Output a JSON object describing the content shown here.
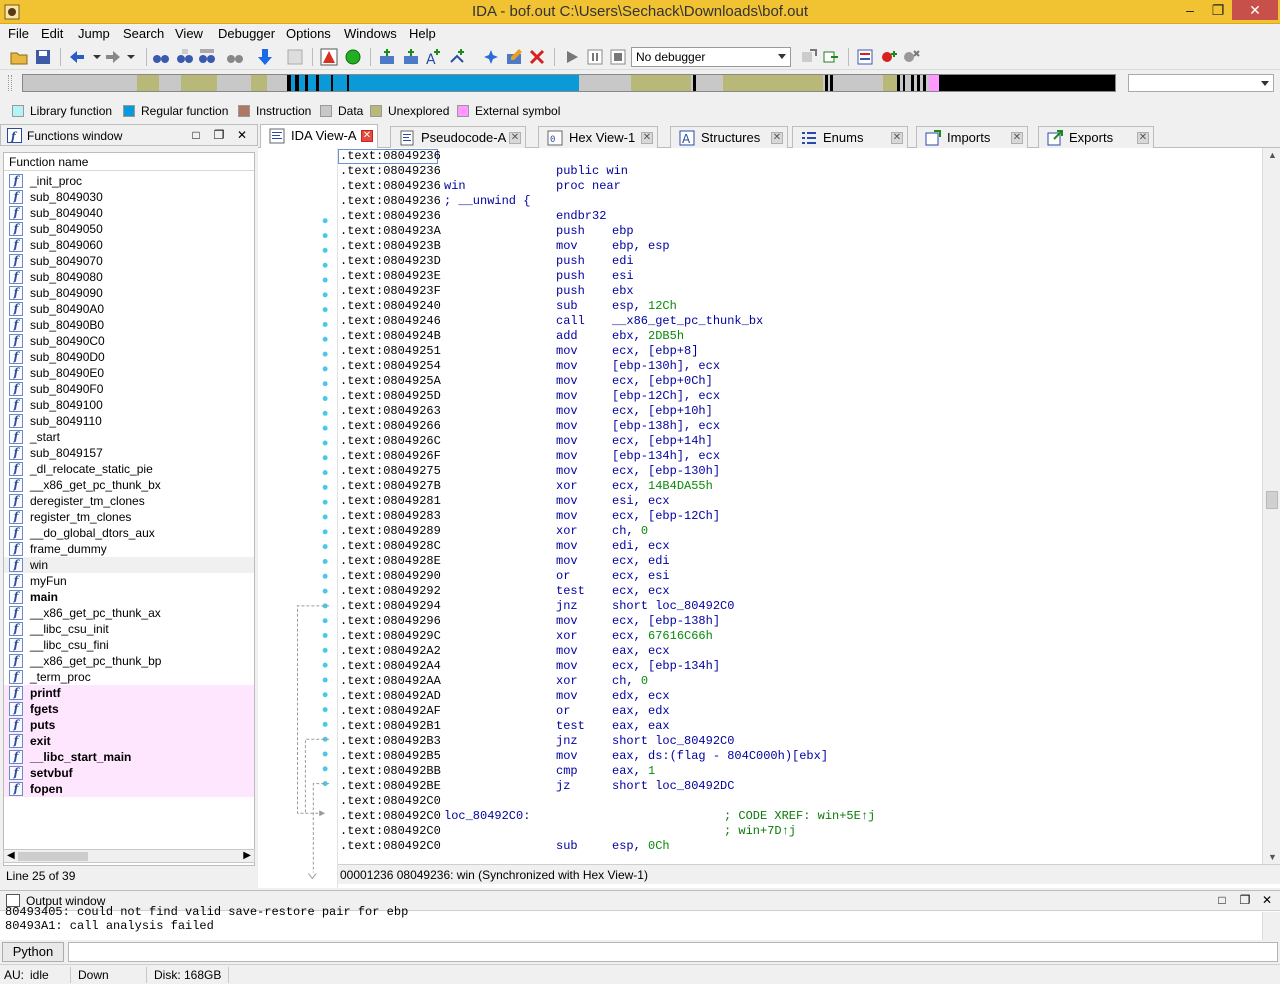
{
  "window": {
    "title": "IDA - bof.out C:\\Users\\Sechack\\Downloads\\bof.out"
  },
  "menu": [
    "File",
    "Edit",
    "Jump",
    "Search",
    "View",
    "Debugger",
    "Options",
    "Windows",
    "Help"
  ],
  "toolbar": {
    "debugger_select": "No debugger"
  },
  "legend": [
    {
      "label": "Library function",
      "color": "#b4f4f4"
    },
    {
      "label": "Regular function",
      "color": "#0a9ad8"
    },
    {
      "label": "Instruction",
      "color": "#b07860"
    },
    {
      "label": "Data",
      "color": "#c8c8c8"
    },
    {
      "label": "Unexplored",
      "color": "#b8b878"
    },
    {
      "label": "External symbol",
      "color": "#ff99ff"
    }
  ],
  "functions_window": {
    "title": "Functions window",
    "column": "Function name",
    "items": [
      {
        "name": "_init_proc",
        "kind": "regular"
      },
      {
        "name": "sub_8049030",
        "kind": "regular"
      },
      {
        "name": "sub_8049040",
        "kind": "regular"
      },
      {
        "name": "sub_8049050",
        "kind": "regular"
      },
      {
        "name": "sub_8049060",
        "kind": "regular"
      },
      {
        "name": "sub_8049070",
        "kind": "regular"
      },
      {
        "name": "sub_8049080",
        "kind": "regular"
      },
      {
        "name": "sub_8049090",
        "kind": "regular"
      },
      {
        "name": "sub_80490A0",
        "kind": "regular"
      },
      {
        "name": "sub_80490B0",
        "kind": "regular"
      },
      {
        "name": "sub_80490C0",
        "kind": "regular"
      },
      {
        "name": "sub_80490D0",
        "kind": "regular"
      },
      {
        "name": "sub_80490E0",
        "kind": "regular"
      },
      {
        "name": "sub_80490F0",
        "kind": "regular"
      },
      {
        "name": "sub_8049100",
        "kind": "regular"
      },
      {
        "name": "sub_8049110",
        "kind": "regular"
      },
      {
        "name": "_start",
        "kind": "regular"
      },
      {
        "name": "sub_8049157",
        "kind": "regular"
      },
      {
        "name": "_dl_relocate_static_pie",
        "kind": "regular"
      },
      {
        "name": "__x86_get_pc_thunk_bx",
        "kind": "regular"
      },
      {
        "name": "deregister_tm_clones",
        "kind": "regular"
      },
      {
        "name": "register_tm_clones",
        "kind": "regular"
      },
      {
        "name": "__do_global_dtors_aux",
        "kind": "regular"
      },
      {
        "name": "frame_dummy",
        "kind": "regular"
      },
      {
        "name": "win",
        "kind": "selected"
      },
      {
        "name": "myFun",
        "kind": "regular"
      },
      {
        "name": "main",
        "kind": "bold"
      },
      {
        "name": "__x86_get_pc_thunk_ax",
        "kind": "regular"
      },
      {
        "name": "__libc_csu_init",
        "kind": "regular"
      },
      {
        "name": "__libc_csu_fini",
        "kind": "regular"
      },
      {
        "name": "__x86_get_pc_thunk_bp",
        "kind": "regular"
      },
      {
        "name": "_term_proc",
        "kind": "regular"
      },
      {
        "name": "printf",
        "kind": "external"
      },
      {
        "name": "fgets",
        "kind": "external"
      },
      {
        "name": "puts",
        "kind": "external"
      },
      {
        "name": "exit",
        "kind": "external"
      },
      {
        "name": "__libc_start_main",
        "kind": "external"
      },
      {
        "name": "setvbuf",
        "kind": "external"
      },
      {
        "name": "fopen",
        "kind": "external"
      }
    ],
    "footer": "Line 25 of 39"
  },
  "tabs": [
    {
      "label": "IDA View-A",
      "active": true
    },
    {
      "label": "Pseudocode-A",
      "active": false
    },
    {
      "label": "Hex View-1",
      "active": false
    },
    {
      "label": "Structures",
      "active": false
    },
    {
      "label": "Enums",
      "active": false
    },
    {
      "label": "Imports",
      "active": false
    },
    {
      "label": "Exports",
      "active": false
    }
  ],
  "disasm": [
    {
      "addr": ".text:08049236"
    },
    {
      "addr": ".text:08049236",
      "dir": "public win"
    },
    {
      "addr": ".text:08049236",
      "lbl": "win",
      "dir": "proc near"
    },
    {
      "addr": ".text:08049236",
      "lbl": "; __unwind {"
    },
    {
      "addr": ".text:08049236",
      "mn": "endbr32"
    },
    {
      "addr": ".text:0804923A",
      "mn": "push",
      "op": "ebp"
    },
    {
      "addr": ".text:0804923B",
      "mn": "mov",
      "op": "ebp, esp"
    },
    {
      "addr": ".text:0804923D",
      "mn": "push",
      "op": "edi"
    },
    {
      "addr": ".text:0804923E",
      "mn": "push",
      "op": "esi"
    },
    {
      "addr": ".text:0804923F",
      "mn": "push",
      "op": "ebx"
    },
    {
      "addr": ".text:08049240",
      "mn": "sub",
      "op": "esp, ",
      "num": "12Ch"
    },
    {
      "addr": ".text:08049246",
      "mn": "call",
      "op": "__x86_get_pc_thunk_bx"
    },
    {
      "addr": ".text:0804924B",
      "mn": "add",
      "op": "ebx, ",
      "num": "2DB5h"
    },
    {
      "addr": ".text:08049251",
      "mn": "mov",
      "op": "ecx, [ebp+8]"
    },
    {
      "addr": ".text:08049254",
      "mn": "mov",
      "op": "[ebp-130h], ecx"
    },
    {
      "addr": ".text:0804925A",
      "mn": "mov",
      "op": "ecx, [ebp+0Ch]"
    },
    {
      "addr": ".text:0804925D",
      "mn": "mov",
      "op": "[ebp-12Ch], ecx"
    },
    {
      "addr": ".text:08049263",
      "mn": "mov",
      "op": "ecx, [ebp+10h]"
    },
    {
      "addr": ".text:08049266",
      "mn": "mov",
      "op": "[ebp-138h], ecx"
    },
    {
      "addr": ".text:0804926C",
      "mn": "mov",
      "op": "ecx, [ebp+14h]"
    },
    {
      "addr": ".text:0804926F",
      "mn": "mov",
      "op": "[ebp-134h], ecx"
    },
    {
      "addr": ".text:08049275",
      "mn": "mov",
      "op": "ecx, [ebp-130h]"
    },
    {
      "addr": ".text:0804927B",
      "mn": "xor",
      "op": "ecx, ",
      "num": "14B4DA55h"
    },
    {
      "addr": ".text:08049281",
      "mn": "mov",
      "op": "esi, ecx"
    },
    {
      "addr": ".text:08049283",
      "mn": "mov",
      "op": "ecx, [ebp-12Ch]"
    },
    {
      "addr": ".text:08049289",
      "mn": "xor",
      "op": "ch, ",
      "num": "0"
    },
    {
      "addr": ".text:0804928C",
      "mn": "mov",
      "op": "edi, ecx"
    },
    {
      "addr": ".text:0804928E",
      "mn": "mov",
      "op": "ecx, edi"
    },
    {
      "addr": ".text:08049290",
      "mn": "or",
      "op": "ecx, esi"
    },
    {
      "addr": ".text:08049292",
      "mn": "test",
      "op": "ecx, ecx"
    },
    {
      "addr": ".text:08049294",
      "mn": "jnz",
      "op": "short loc_80492C0"
    },
    {
      "addr": ".text:08049296",
      "mn": "mov",
      "op": "ecx, [ebp-138h]"
    },
    {
      "addr": ".text:0804929C",
      "mn": "xor",
      "op": "ecx, ",
      "num": "67616C66h"
    },
    {
      "addr": ".text:080492A2",
      "mn": "mov",
      "op": "eax, ecx"
    },
    {
      "addr": ".text:080492A4",
      "mn": "mov",
      "op": "ecx, [ebp-134h]"
    },
    {
      "addr": ".text:080492AA",
      "mn": "xor",
      "op": "ch, ",
      "num": "0"
    },
    {
      "addr": ".text:080492AD",
      "mn": "mov",
      "op": "edx, ecx"
    },
    {
      "addr": ".text:080492AF",
      "mn": "or",
      "op": "eax, edx"
    },
    {
      "addr": ".text:080492B1",
      "mn": "test",
      "op": "eax, eax"
    },
    {
      "addr": ".text:080492B3",
      "mn": "jnz",
      "op": "short loc_80492C0"
    },
    {
      "addr": ".text:080492B5",
      "mn": "mov",
      "op": "eax, ds:(flag - 804C000h)[ebx]"
    },
    {
      "addr": ".text:080492BB",
      "mn": "cmp",
      "op": "eax, ",
      "num": "1"
    },
    {
      "addr": ".text:080492BE",
      "mn": "jz",
      "op": "short loc_80492DC"
    },
    {
      "addr": ".text:080492C0"
    },
    {
      "addr": ".text:080492C0",
      "lbl": "loc_80492C0:",
      "cmt": "; CODE XREF: win+5E↑j"
    },
    {
      "addr": ".text:080492C0",
      "cmt": "; win+7D↑j"
    },
    {
      "addr": ".text:080492C0",
      "mn": "sub",
      "op": "esp, ",
      "num": "0Ch"
    }
  ],
  "disasm_status": "00001236 08049236: win (Synchronized with Hex View-1)",
  "output": {
    "title": "Output window",
    "lines": [
      "80493405: could not find valid save-restore pair for ebp",
      "80493A1: call analysis failed"
    ]
  },
  "python_button": "Python",
  "statusbar": {
    "au": "AU:",
    "state": "idle",
    "direction": "Down",
    "disk": "Disk: 168GB"
  }
}
